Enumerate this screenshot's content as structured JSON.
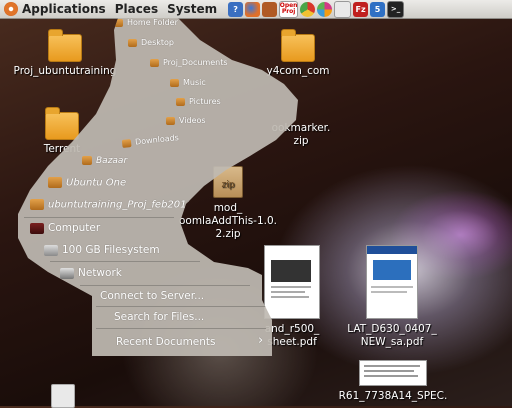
{
  "panel": {
    "menus": [
      "Applications",
      "Places",
      "System"
    ],
    "launchers": [
      {
        "name": "help-icon",
        "color": "#3a6fc1"
      },
      {
        "name": "firefox-icon",
        "color": "#e0702a"
      },
      {
        "name": "butterfly-icon",
        "color": "#b05a24"
      },
      {
        "name": "openproj-icon",
        "label": "Open Proj"
      },
      {
        "name": "chrome-icon",
        "color": "#4aa548"
      },
      {
        "name": "picasa-icon",
        "color": "#d23a86"
      },
      {
        "name": "mail-icon",
        "color": "#cfcfcf"
      },
      {
        "name": "filezilla-icon",
        "color": "#c0201e",
        "label": "Fz"
      },
      {
        "name": "five-icon",
        "color": "#2f70c4",
        "label": "5"
      },
      {
        "name": "terminal-icon",
        "color": "#222222",
        "label": ">_"
      }
    ]
  },
  "desktop": {
    "icons": {
      "proj_ubuntutraining": "Proj_ubuntutraining",
      "terrent": "Terrent",
      "y4com": "y4com_com",
      "bookmarker": [
        "ookmarker.",
        "zip"
      ],
      "zip_badge": "zip",
      "joomla": [
        "mod_",
        "oomlaAddThis-1.0.",
        "2.zip"
      ],
      "pdf1": [
        "and_r500_",
        "sheet.pdf"
      ],
      "pdf2": [
        "LAT_D630_0407_",
        "NEW_sa.pdf"
      ],
      "pdf3": [
        "R61_7738A14_SPEC."
      ]
    }
  },
  "places_menu": {
    "items": [
      {
        "label": "Home Folder",
        "icon": "home-folder-icon"
      },
      {
        "label": "Desktop",
        "icon": "desktop-icon"
      },
      {
        "label": "Proj_Documents",
        "icon": "folder-icon"
      },
      {
        "label": "Music",
        "icon": "music-icon"
      },
      {
        "label": "Pictures",
        "icon": "pictures-icon"
      },
      {
        "label": "Videos",
        "icon": "videos-icon"
      },
      {
        "label": "Downloads",
        "icon": "downloads-icon"
      },
      {
        "label": "Bazaar",
        "icon": "folder-icon"
      },
      {
        "label": "Ubuntu One",
        "icon": "folder-icon"
      },
      {
        "label": "ubuntutraining_Proj_feb2010",
        "icon": "folder-icon"
      },
      {
        "label": "Computer",
        "icon": "computer-icon"
      },
      {
        "label": "100 GB Filesystem",
        "icon": "drive-icon"
      },
      {
        "label": "Network",
        "icon": "network-icon"
      },
      {
        "label": "Connect to Server...",
        "icon": ""
      },
      {
        "label": "Search for Files...",
        "icon": ""
      },
      {
        "label": "Recent Documents",
        "icon": ""
      }
    ],
    "submenu_arrow": "›"
  }
}
